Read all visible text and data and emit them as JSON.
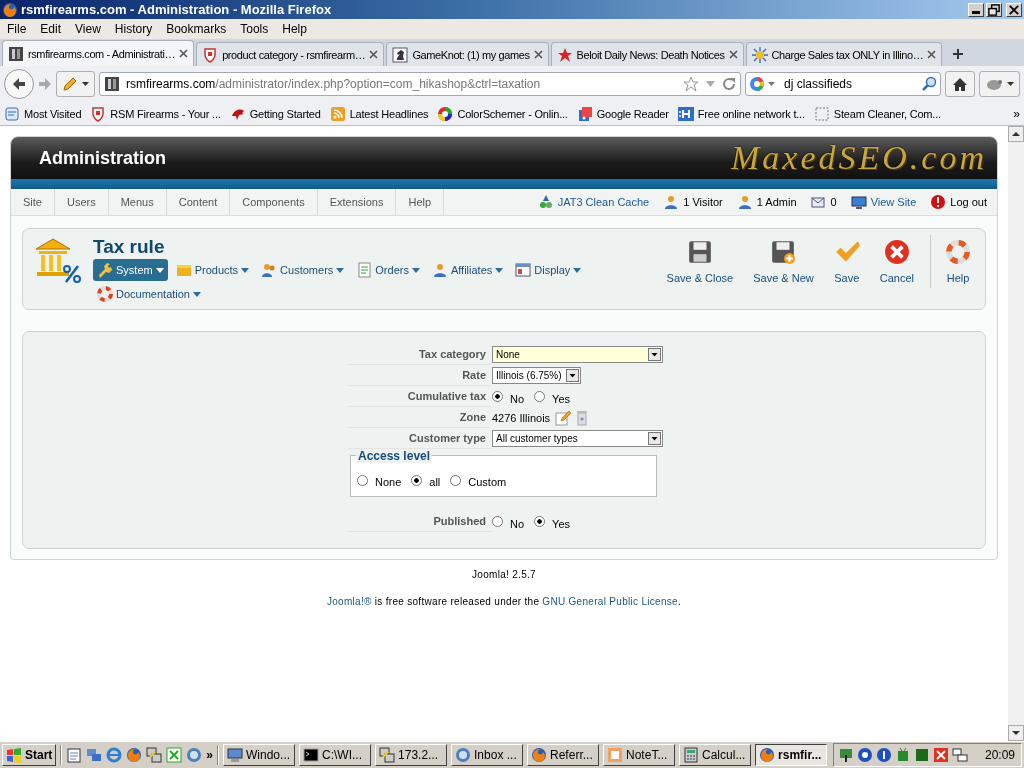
{
  "window": {
    "title": "rsmfirearms.com - Administration - Mozilla Firefox"
  },
  "menu_bar": [
    "File",
    "Edit",
    "View",
    "History",
    "Bookmarks",
    "Tools",
    "Help"
  ],
  "tabs": [
    {
      "label": "rsmfirearms.com - Administrati…",
      "selected": true
    },
    {
      "label": "product category - rsmfirearm…",
      "selected": false
    },
    {
      "label": "GameKnot: (1) my games",
      "selected": false
    },
    {
      "label": "Beloit Daily News: Death Notices",
      "selected": false
    },
    {
      "label": "Charge Sales tax ONLY in Illino…",
      "selected": false
    }
  ],
  "address_bar": {
    "domain": "rsmfirearms.com",
    "path": "/administrator/index.php?option=com_hikashop&ctrl=taxation"
  },
  "search_bar": {
    "value": "dj classifieds"
  },
  "bookmarks": [
    "Most Visited",
    "RSM Firearms - Your ...",
    "Getting Started",
    "Latest Headlines",
    "ColorSchemer - Onlin...",
    "Google Reader",
    "Free online network t...",
    "Steam Cleaner, Com..."
  ],
  "bookmarks_more": "»",
  "admin": {
    "title": "Administration",
    "logo": "MaxedSEO.com",
    "menu": [
      "Site",
      "Users",
      "Menus",
      "Content",
      "Components",
      "Extensions",
      "Help"
    ],
    "status": [
      {
        "label": "JAT3 Clean Cache",
        "link": true
      },
      {
        "label": "1 Visitor",
        "link": false
      },
      {
        "label": "1 Admin",
        "link": false
      },
      {
        "label": "0",
        "link": false
      },
      {
        "label": "View Site",
        "link": true
      },
      {
        "label": "Log out",
        "link": false
      }
    ]
  },
  "page": {
    "title": "Tax rule",
    "menu": [
      {
        "label": "System",
        "selected": true
      },
      {
        "label": "Products",
        "selected": false
      },
      {
        "label": "Customers",
        "selected": false
      },
      {
        "label": "Orders",
        "selected": false
      },
      {
        "label": "Affiliates",
        "selected": false
      },
      {
        "label": "Display",
        "selected": false
      },
      {
        "label": "Documentation",
        "selected": false
      }
    ],
    "actions": [
      {
        "label": "Save & Close",
        "separated": false
      },
      {
        "label": "Save & New",
        "separated": false
      },
      {
        "label": "Save",
        "separated": false
      },
      {
        "label": "Cancel",
        "separated": false
      },
      {
        "label": "Help",
        "separated": true
      }
    ]
  },
  "form": {
    "fields": [
      {
        "kind": "select",
        "label": "Tax category",
        "value": "None",
        "focused": true,
        "wide": true
      },
      {
        "kind": "select",
        "label": "Rate",
        "value": "Illinois (6.75%)",
        "focused": false,
        "wide": false
      },
      {
        "kind": "radio",
        "label": "Cumulative tax",
        "options": [
          {
            "label": "No",
            "selected": true
          },
          {
            "label": "Yes",
            "selected": false
          }
        ]
      },
      {
        "kind": "zone",
        "label": "Zone",
        "value": "4276 Illinois"
      },
      {
        "kind": "select",
        "label": "Customer type",
        "value": "All customer types",
        "focused": false,
        "wide": true
      },
      {
        "kind": "fieldset",
        "label": "Access level",
        "options": [
          {
            "label": "None",
            "selected": false
          },
          {
            "label": "all",
            "selected": true
          },
          {
            "label": "Custom",
            "selected": false
          }
        ]
      },
      {
        "kind": "radio",
        "label": "Published",
        "options": [
          {
            "label": "No",
            "selected": false
          },
          {
            "label": "Yes",
            "selected": true
          }
        ]
      }
    ]
  },
  "footer": {
    "version": "Joomla! 2.5.7",
    "license": {
      "product_link": "Joomla!®",
      "text": " is free software released under the ",
      "license_link": "GNU General Public License",
      "end": "."
    }
  },
  "taskbar": {
    "start": "Start",
    "more": "»",
    "tasks": [
      {
        "label": "Windo...",
        "selected": false
      },
      {
        "label": "C:\\WI...",
        "selected": false
      },
      {
        "label": "173.2...",
        "selected": false
      },
      {
        "label": "Inbox ...",
        "selected": false
      },
      {
        "label": "Referr...",
        "selected": false
      },
      {
        "label": "NoteT...",
        "selected": false
      },
      {
        "label": "Calcul...",
        "selected": false
      },
      {
        "label": "rsmfir...",
        "selected": true
      }
    ],
    "clock": "20:09"
  }
}
